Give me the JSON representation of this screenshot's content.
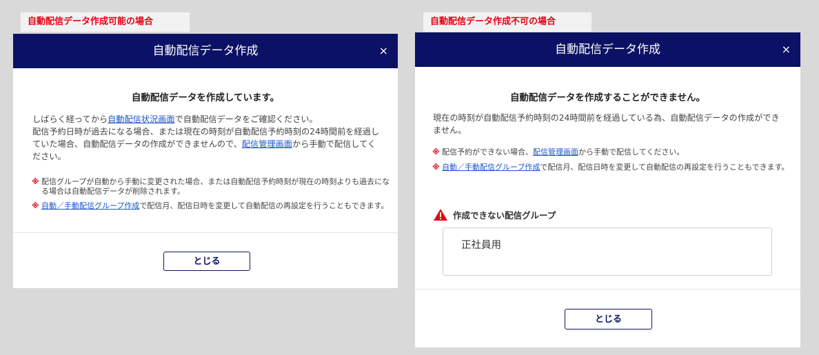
{
  "left": {
    "tag": "自動配信データ作成可能の場合",
    "title": "自動配信データ作成",
    "close": "×",
    "heading": "自動配信データを作成しています。",
    "p1_pre": "しばらく経ってから",
    "p1_link": "自動配信状況画面",
    "p1_post": "で自動配信データをご確認ください。",
    "p2_pre": "配信予約日時が過去になる場合、または現在の時刻が自動配信予約時刻の24時間前を経過していた場合、自動配信データの作成ができませんので、",
    "p2_link": "配信管理画面",
    "p2_post": "から手動で配信してください。",
    "note_mark": "※",
    "note1": "配信グループが自動から手動に変更された場合、または自動配信予約時刻が現在の時刻よりも過去になる場合は自動配信データが削除されます。",
    "note2_link": "自動／手動配信グループ作成",
    "note2_post": "で配信月、配信日時を変更して自動配信の再設定を行うこともできます。",
    "button": "とじる"
  },
  "right": {
    "tag": "自動配信データ作成不可の場合",
    "title": "自動配信データ作成",
    "close": "×",
    "heading": "自動配信データを作成することができません。",
    "p1": "現在の時刻が自動配信予約時刻の24時間前を経過している為、自動配信データの作成ができません。",
    "note_mark": "※",
    "note1_pre": "配信予約ができない場合、",
    "note1_link": "配信管理画面",
    "note1_post": "から手動で配信してください。",
    "note2_link": "自動／手動配信グループ作成",
    "note2_post": "で配信月、配信日時を変更して自動配信の再設定を行うこともできます。",
    "warn_label": "作成できない配信グループ",
    "group_value": "正社員用",
    "button": "とじる"
  },
  "colors": {
    "header": "#0b1164",
    "mark": "#e60012",
    "link": "#1a56c8",
    "warn": "#e60012"
  }
}
